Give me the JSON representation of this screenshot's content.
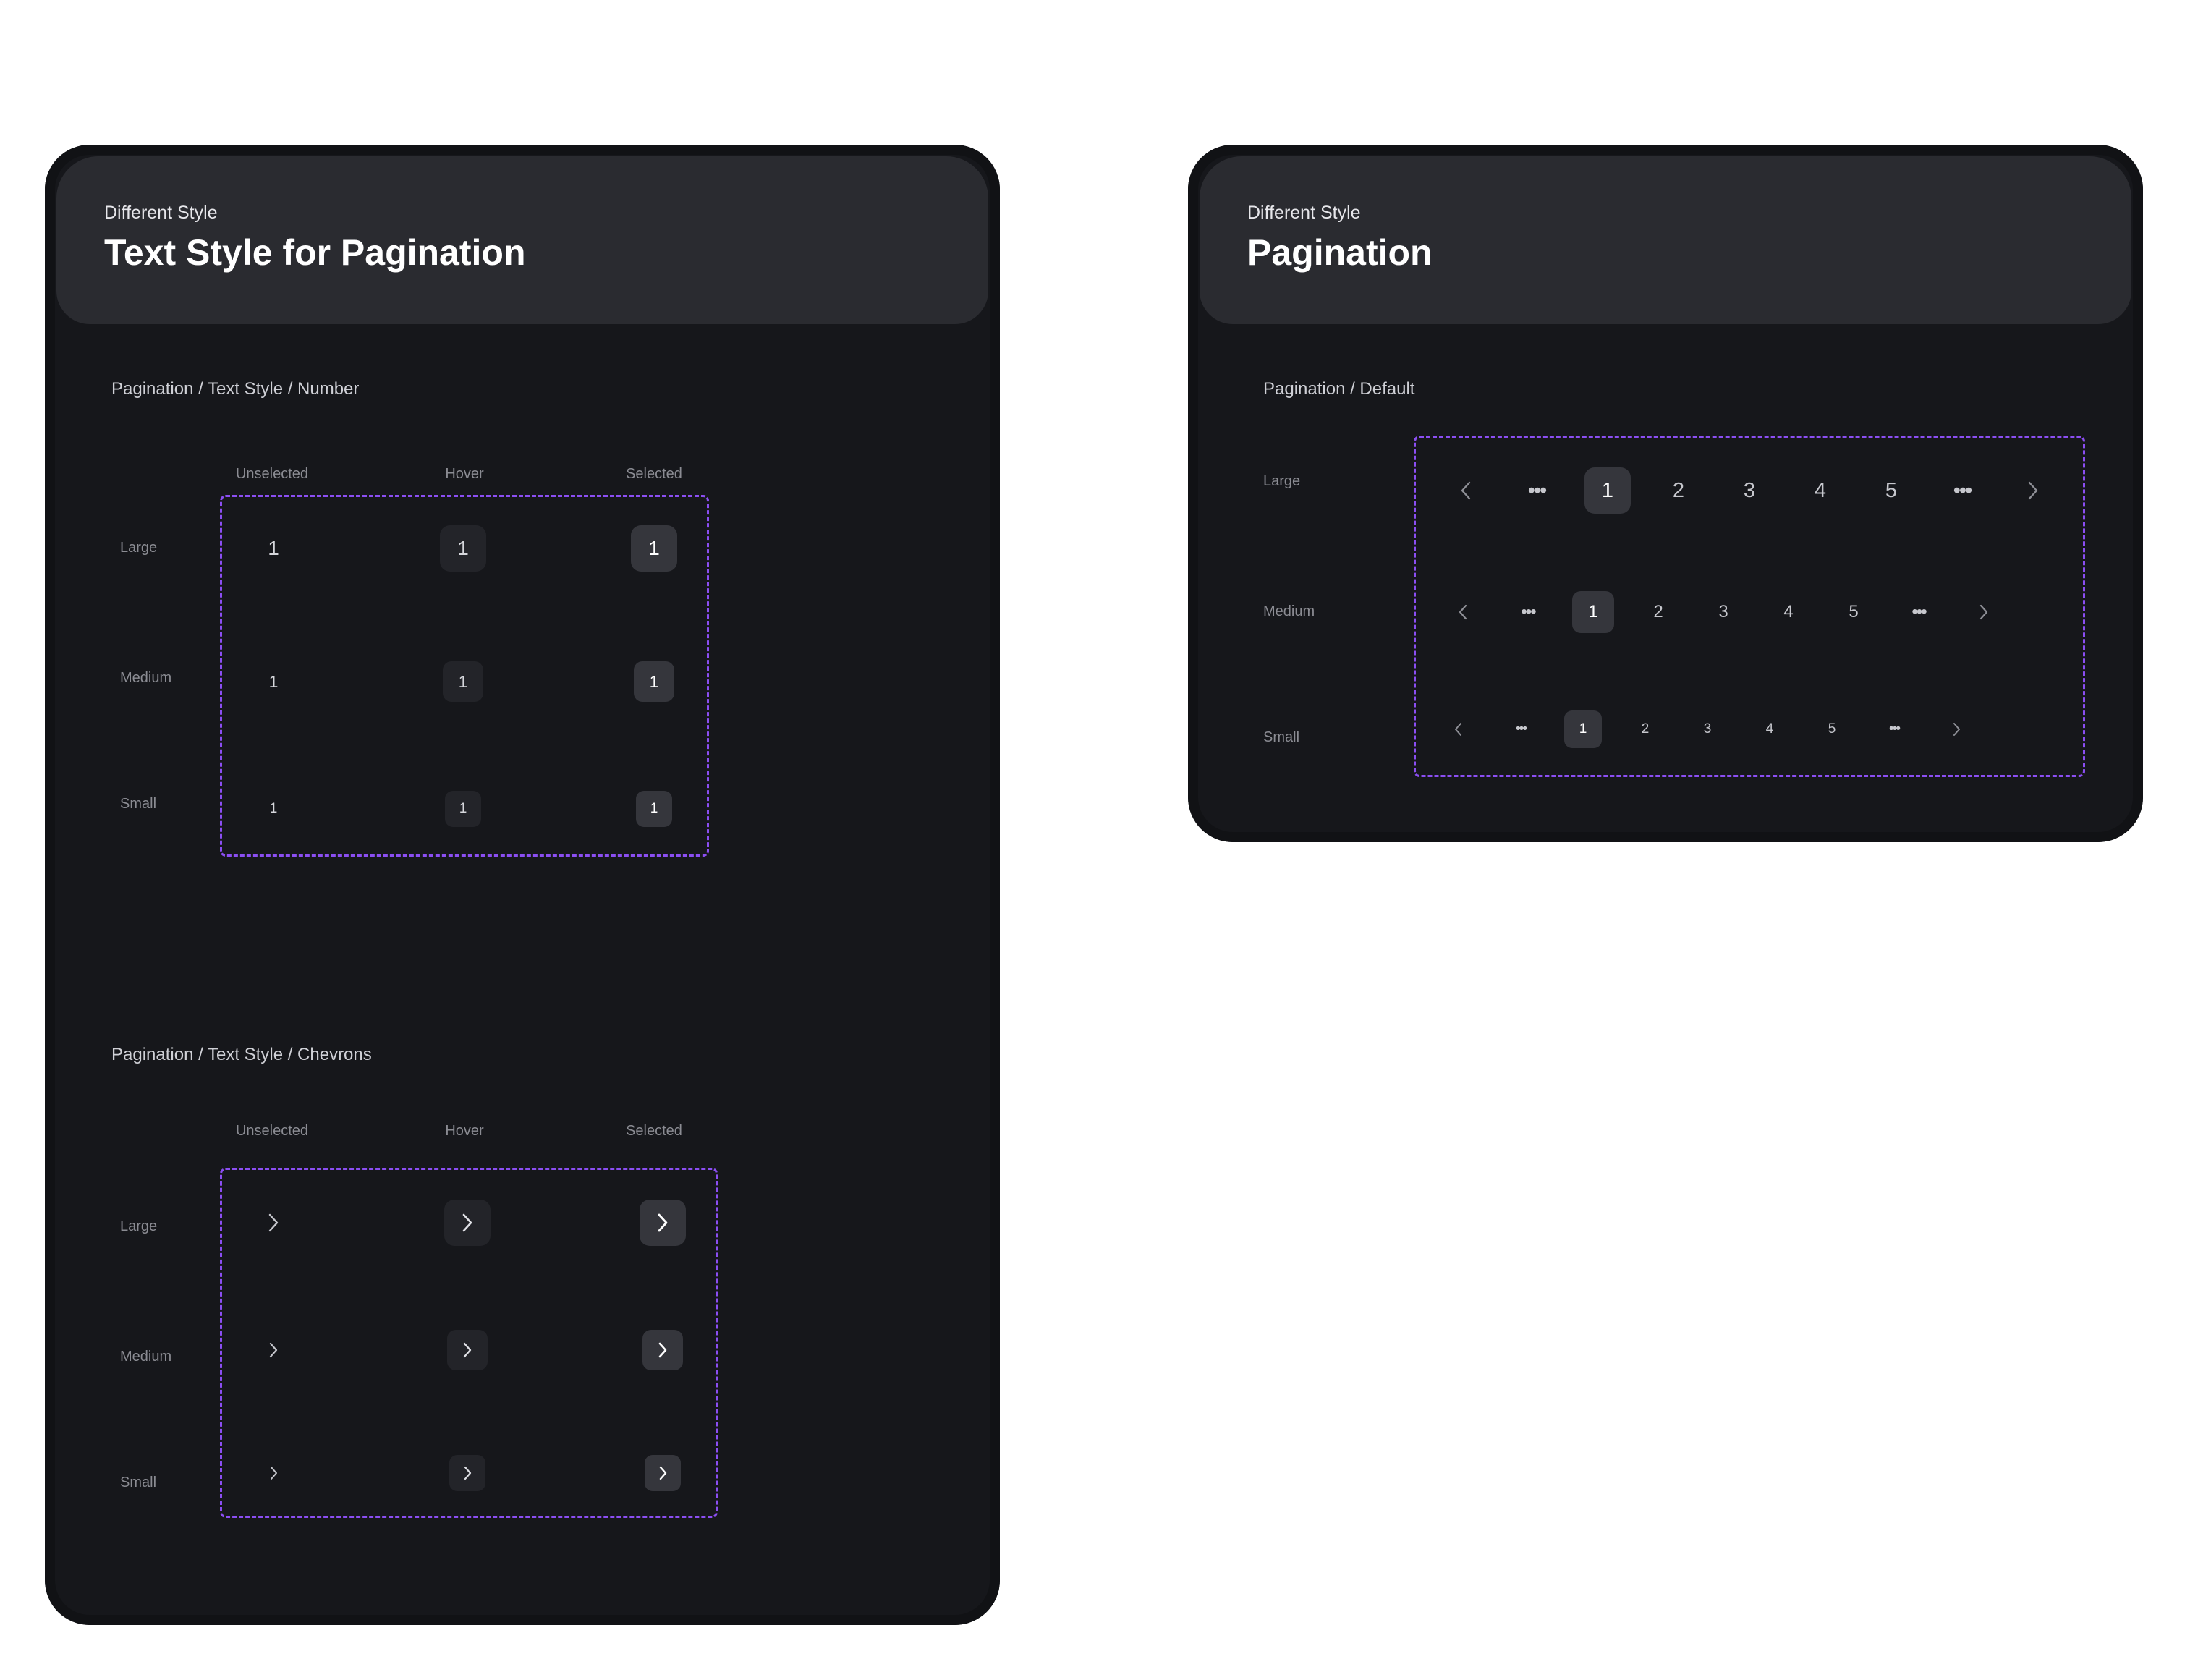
{
  "left_card": {
    "eyebrow": "Different Style",
    "title": "Text Style for Pagination",
    "number_section": {
      "label": "Pagination / Text Style / Number",
      "columns": [
        "Unselected",
        "Hover",
        "Selected"
      ],
      "rows": [
        "Large",
        "Medium",
        "Small"
      ],
      "value": "1"
    },
    "chevron_section": {
      "label": "Pagination / Text Style / Chevrons",
      "columns": [
        "Unselected",
        "Hover",
        "Selected"
      ],
      "rows": [
        "Large",
        "Medium",
        "Small"
      ]
    }
  },
  "right_card": {
    "eyebrow": "Different Style",
    "title": "Pagination",
    "section": {
      "label": "Pagination / Default",
      "rows": [
        "Large",
        "Medium",
        "Small"
      ],
      "pages": [
        "1",
        "2",
        "3",
        "4",
        "5"
      ],
      "selected_page": "1",
      "ellipsis": "•••"
    }
  },
  "colors": {
    "card_bg": "#16171b",
    "header_bg": "#2a2b30",
    "dashed_border": "#8b4ef2",
    "selected_bg": "#35363c",
    "hover_bg": "#232429"
  },
  "icons": [
    "chevron-right-icon",
    "chevron-left-icon",
    "ellipsis-icon"
  ]
}
